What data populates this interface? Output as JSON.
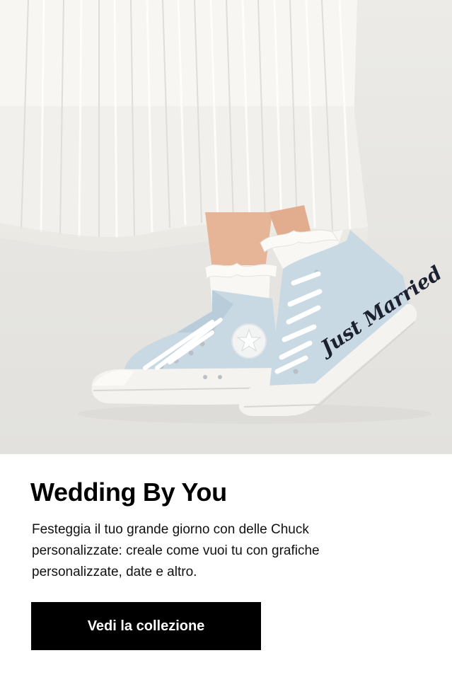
{
  "hero": {
    "image_subject": "white pleated skirt with light blue high-top sneakers",
    "shoe_print_text": "Just Married",
    "colors": {
      "background": "#e6e5e1",
      "skirt": "#f7f6f3",
      "shoe_canvas": "#c9d9e4",
      "rubber": "#f4f3ef",
      "script_text": "#1b2130"
    }
  },
  "content": {
    "title": "Wedding By You",
    "description": "Festeggia il tuo grande giorno con delle Chuck personalizzate: creale come vuoi tu con grafiche personalizzate, date e altro.",
    "cta_label": "Vedi la collezione"
  },
  "colors": {
    "text": "#000000",
    "button_bg": "#000000",
    "button_text": "#ffffff"
  }
}
